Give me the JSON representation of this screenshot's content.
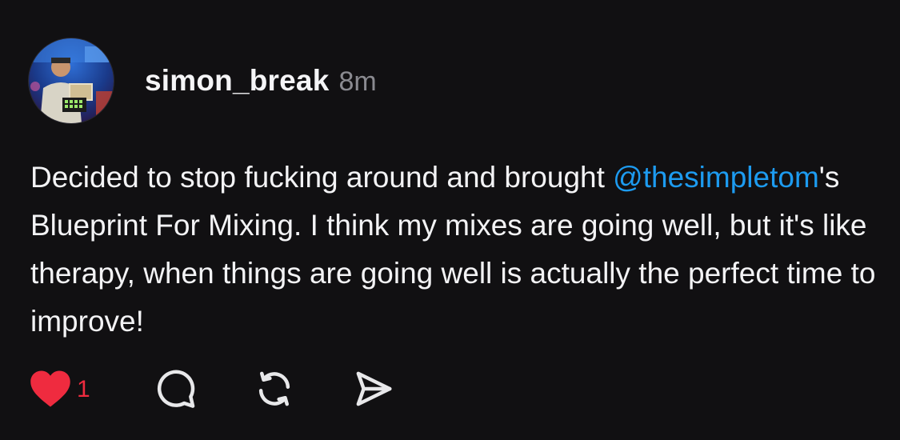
{
  "post": {
    "author": {
      "username": "simon_break",
      "avatar_icon": "profile-photo-icon"
    },
    "timestamp": "8m",
    "text": {
      "part1": "Decided to stop fucking around and brought ",
      "mention": "@thesimpletom",
      "part2": "'s Blueprint For Mixing. I think my mixes are going well, but it's like therapy, when things are going well is actually the perfect time to improve!"
    },
    "actions": {
      "like": {
        "icon": "heart-icon",
        "count": "1",
        "liked": true,
        "color": "#ef2b3f"
      },
      "reply": {
        "icon": "comment-icon"
      },
      "repost": {
        "icon": "repost-icon"
      },
      "share": {
        "icon": "send-icon"
      }
    }
  },
  "colors": {
    "background": "#111012",
    "text": "#f3f3f5",
    "muted": "#8a8a90",
    "mention": "#1d9bf0",
    "like": "#ef2b3f"
  }
}
